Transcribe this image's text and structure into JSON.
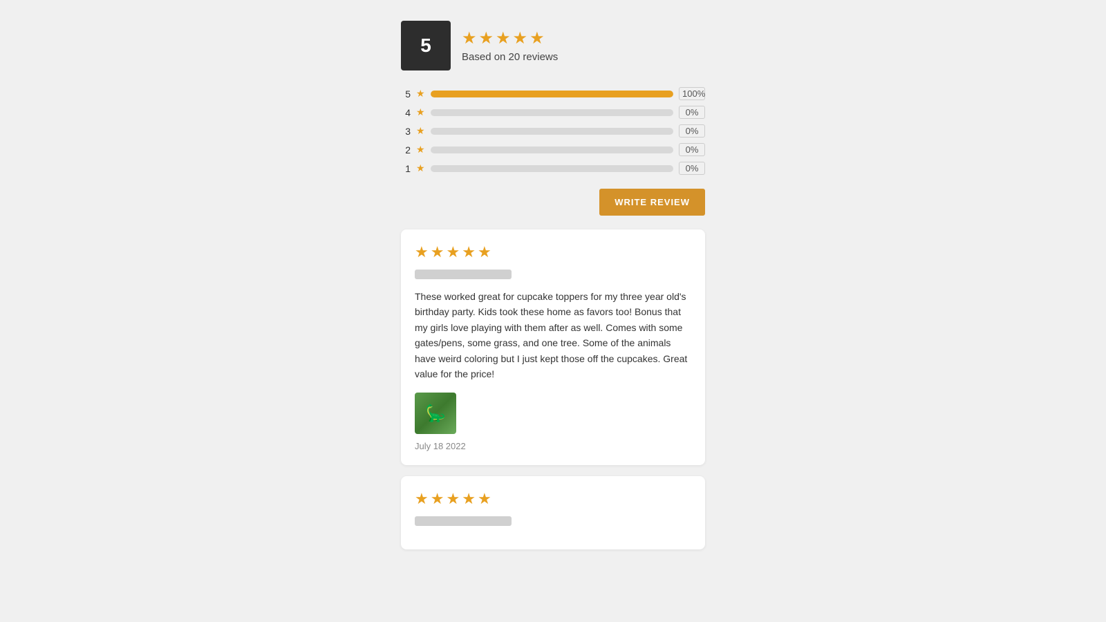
{
  "rating_summary": {
    "score": "5",
    "stars_count": 5,
    "based_on_label": "Based on 20 reviews"
  },
  "rating_bars": [
    {
      "label": "5",
      "pct_display": "100%",
      "pct_value": 100
    },
    {
      "label": "4",
      "pct_display": "0%",
      "pct_value": 0
    },
    {
      "label": "3",
      "pct_display": "0%",
      "pct_value": 0
    },
    {
      "label": "2",
      "pct_display": "0%",
      "pct_value": 0
    },
    {
      "label": "1",
      "pct_display": "0%",
      "pct_value": 0
    }
  ],
  "write_review_btn": "WRITE REVIEW",
  "reviews": [
    {
      "stars": 5,
      "text": "These worked great for cupcake toppers for my three year old's birthday party. Kids took these home as favors too! Bonus that my girls love playing with them after as well. Comes with some gates/pens, some grass, and one tree. Some of the animals have weird coloring but I just kept those off the cupcakes. Great value for the price!",
      "has_image": true,
      "date": "July 18 2022"
    },
    {
      "stars": 5,
      "text": "",
      "has_image": false,
      "date": ""
    }
  ]
}
